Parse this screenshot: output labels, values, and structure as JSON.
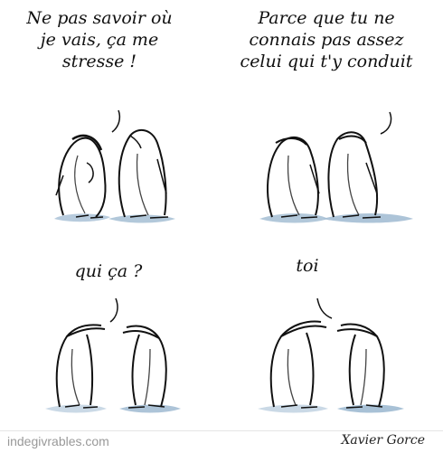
{
  "panels": [
    {
      "speech": "Ne pas savoir où\nje vais, ça me\nstresse !"
    },
    {
      "speech": "Parce que tu ne\nconnais pas assez\ncelui qui t'y conduit"
    },
    {
      "speech": "qui ça ?"
    },
    {
      "speech": "toi"
    }
  ],
  "footer": {
    "site": "indegivrables.com",
    "signature": "Xavier Gorce"
  },
  "colors": {
    "ink": "#111111",
    "wash": "#9fbad1",
    "footer_text": "#999999"
  }
}
